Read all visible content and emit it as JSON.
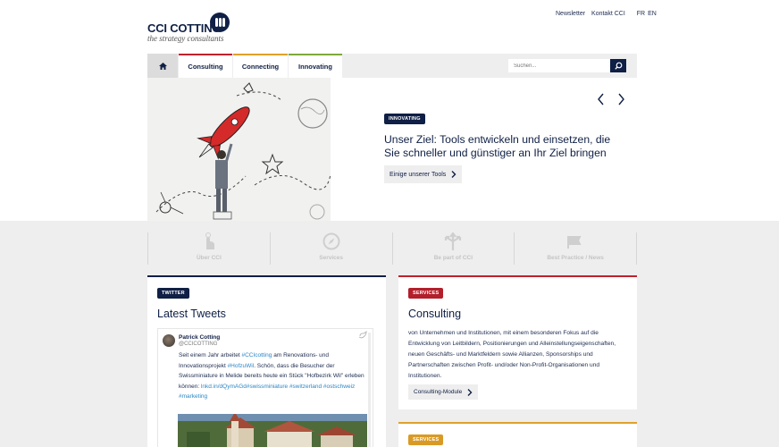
{
  "brand": {
    "name": "CCI COTTING",
    "tagline": "the strategy consultants",
    "navy": "#0f1f45"
  },
  "toplinks": {
    "newsletter": "Newsletter",
    "contact": "Kontakt CCI",
    "lang_fr": "FR",
    "lang_en": "EN"
  },
  "nav": {
    "home_icon": "home-icon",
    "tabs": [
      {
        "label": "Consulting",
        "color": "#c0212c"
      },
      {
        "label": "Connecting",
        "color": "#e0a02b"
      },
      {
        "label": "Innovating",
        "color": "#7ea83b"
      }
    ],
    "search_placeholder": "Suchen..."
  },
  "hero": {
    "badge": "INNOVATING",
    "title": "Unser Ziel: Tools entwickeln und einsetzen, die Sie schneller und günstiger an Ihr Ziel bringen",
    "button": "Einige unserer Tools"
  },
  "quicklinks": [
    {
      "label": "Über CCI",
      "icon": "pointer-hand-icon"
    },
    {
      "label": "Services",
      "icon": "compass-icon"
    },
    {
      "label": "Be part of CCI",
      "icon": "arrows-split-icon"
    },
    {
      "label": "Best Practice / News",
      "icon": "megaphone-icon"
    }
  ],
  "twitter": {
    "badge": "TWITTER",
    "title": "Latest Tweets",
    "name": "Patrick Cotting",
    "handle": "@CCICOTTING",
    "text_1": "Seit einem Jahr arbeitet ",
    "link_1": "#CCIcotting",
    "text_2": " am Renovations- und Innovationsprojekt ",
    "link_2": "#HofzuWil",
    "text_3": ". Schön, dass die Besucher der Swissminiature in Melide bereits heute ein Stück \"Hofbezirk Wil\" erleben können: ",
    "link_3": "lnkd.in/dQymAGd",
    "link_4": "#swissminiature",
    "link_5": "#switzerland",
    "link_6": "#ostschweiz",
    "link_7": "#marketing"
  },
  "consulting": {
    "badge": "SERVICES",
    "title": "Consulting",
    "text": "von Unternehmen und Institutionen, mit einem besonderen Fokus auf die Entwicklung von Leitbildern, Positionierungen und Alleinstellungseigenschaften, neuen Geschäfts- und Marktfeldern sowie Allianzen, Sponsorships und Partnerschaften zwischen Profit- und/oder Non-Profit-Organisationen und Institutionen.",
    "button": "Consulting-Module"
  },
  "services2": {
    "badge": "SERVICES"
  }
}
